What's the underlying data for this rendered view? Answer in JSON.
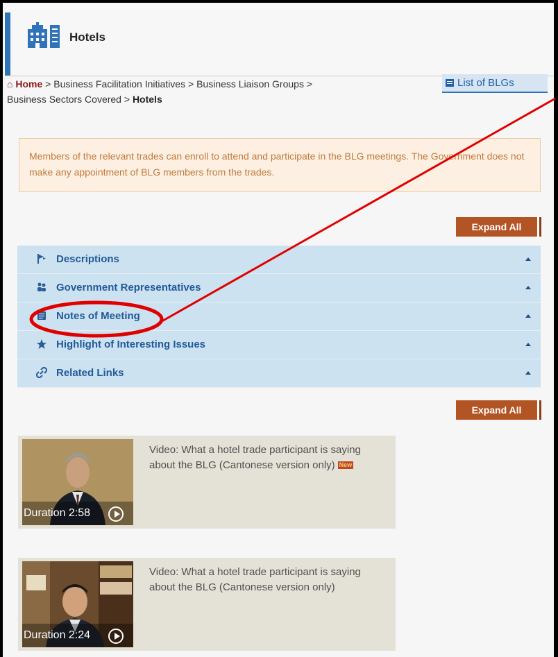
{
  "header": {
    "title": "Hotels",
    "icon": "hotel-building-icon"
  },
  "breadcrumb": {
    "home_icon": "home-icon",
    "home": "Home",
    "sep1": " > ",
    "item1": "Business Facilitation Initiatives",
    "sep2": " > ",
    "item2": "Business Liaison Groups",
    "sep3": " > ",
    "item3": "Business Sectors Covered",
    "sep4": " > ",
    "current": "Hotels"
  },
  "list_blgs": {
    "label": "List of BLGs",
    "icon": "list-icon"
  },
  "notice": {
    "text": "Members of the relevant trades can enroll to attend and participate in the BLG meetings. The Government does not make any appointment of BLG members from the trades."
  },
  "expand_all_label": "Expand All",
  "accordion": {
    "items": [
      {
        "label": "Descriptions",
        "icon": "flag-icon"
      },
      {
        "label": "Government Representatives",
        "icon": "people-icon"
      },
      {
        "label": "Notes of Meeting",
        "icon": "notes-icon"
      },
      {
        "label": "Highlight of Interesting Issues",
        "icon": "star-icon"
      },
      {
        "label": "Related Links",
        "icon": "link-icon"
      }
    ]
  },
  "videos": [
    {
      "title": "Video: What a hotel trade participant is saying about the BLG (Cantonese version only)",
      "duration": "Duration 2:58",
      "badge": "New"
    },
    {
      "title": "Video: What a hotel trade participant is saying about the BLG (Cantonese version only)",
      "duration": "Duration 2:24"
    }
  ],
  "colors": {
    "accent": "#2f73b8",
    "button": "#b25424",
    "accordion_bg": "#cce2f1",
    "annotation": "#e00000"
  }
}
